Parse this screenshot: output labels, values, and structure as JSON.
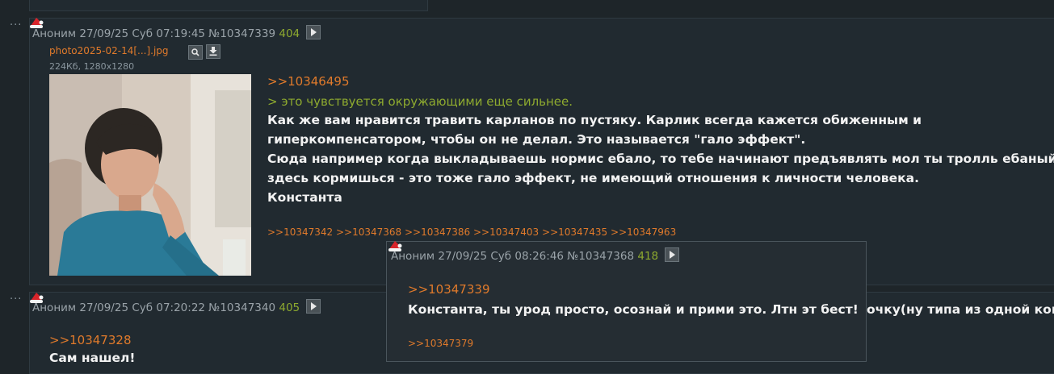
{
  "post1": {
    "author": "Аноним",
    "date": "27/09/25 Суб 07:19:45",
    "post_id": "№10347339",
    "ordinal": "404",
    "file": {
      "name": "photo2025-02-14[...].jpg",
      "info": "224Кб, 1280x1280"
    },
    "reply_to": ">>10346495",
    "quote": "> это чувствуется окружающими еще сильнее.",
    "text_lines": [
      "Как же вам нравится травить карланов по пустяку. Карлик всегда кажется обиженным и",
      "гиперкомпенсатором, чтобы он не делал. Это называется \"гало эффект\".",
      "Сюда например когда выкладываешь нормис ебало, то тебе начинают предъявлять мол ты тролль ебаный и",
      "здесь кормишься - это тоже гало эффект, не имеющий отношения к личности человека.",
      "Константа"
    ],
    "replies": ">>10347342 >>10347368 >>10347386 >>10347403 >>10347435 >>10347963"
  },
  "post2": {
    "author": "Аноним",
    "date": "27/09/25 Суб 07:20:22",
    "post_id": "№10347340",
    "ordinal": "405",
    "reply_to": ">>10347328",
    "text": "Сам нашел!",
    "overflow_text": "очку(ну типа из одной ком"
  },
  "preview": {
    "author": "Аноним",
    "date": "27/09/25 Суб 08:26:46",
    "post_id": "№10347368",
    "ordinal": "418",
    "reply_to": ">>10347339",
    "text": "Константа, ты урод просто, осознай и прими это. Лтн эт бест!",
    "replies": ">>10347379"
  },
  "icons": {
    "menu": "ellipsis-icon",
    "hat": "santa-hat-icon",
    "play": "play-icon",
    "search": "search-icon",
    "download": "download-icon"
  },
  "colors": {
    "background": "#1e2529",
    "post_background": "#212a30",
    "link": "#e07a2b",
    "quote_green": "#8eaa2f",
    "meta_gray": "#9aa3a9"
  }
}
